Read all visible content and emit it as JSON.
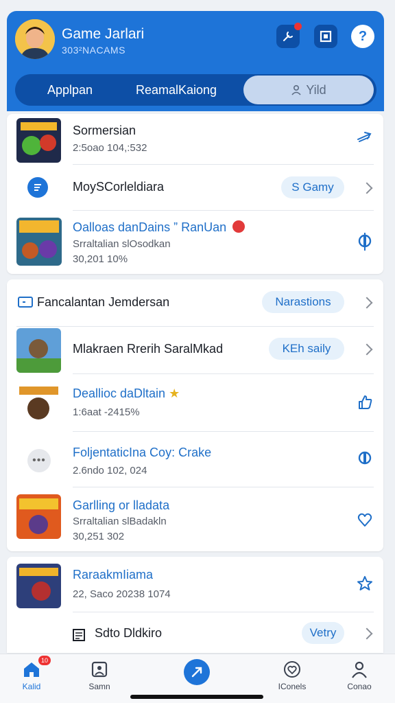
{
  "header": {
    "title": "Game Jarlari",
    "subtitle": "303²NACAMS",
    "tabs": [
      {
        "label": "Applpan"
      },
      {
        "label": "ReamalKaiong"
      },
      {
        "label": "Yild"
      }
    ]
  },
  "card1": {
    "rows": [
      {
        "title": "Sormersian",
        "sub": "2:5oao 104,:532"
      },
      {
        "title": "MoySCorleldiara",
        "pill": "S Gamy"
      },
      {
        "title": "Oalloas danDains ” RanUan",
        "sub1": "Srraltalian slOsodkan",
        "sub2": "30,201 10%"
      }
    ]
  },
  "card2": {
    "rows": [
      {
        "title": "Fancalantan Jemdersan",
        "pill": "Narastions"
      },
      {
        "title": "Mlakraen Rrerih SaralMkad",
        "pill": "KEh saily"
      },
      {
        "title": "Deallioc daDltain",
        "sub": "1:6aat -2415%"
      },
      {
        "title": "FoljentaticIna Coy: Crake",
        "sub": "2.6ndo 102, 024"
      },
      {
        "title": "Garlling or lladata",
        "sub1": "Srraltalian slBadakln",
        "sub2": "30,251 302"
      }
    ]
  },
  "card3": {
    "rows": [
      {
        "title": "RaraakmIiama",
        "sub": "22, Saco  20238 1074"
      },
      {
        "title": "Sdto Dldkiro",
        "pill": "Vetry"
      }
    ]
  },
  "nav": {
    "items": [
      {
        "label": "Kalid",
        "badge": "10"
      },
      {
        "label": "Samn"
      },
      {
        "label": ""
      },
      {
        "label": "IConels"
      },
      {
        "label": "Conao"
      }
    ]
  },
  "colors": {
    "primary": "#1e74d8",
    "dark": "#0d4fa6",
    "pill_bg": "#e6f1fb",
    "badge": "#e33333"
  }
}
